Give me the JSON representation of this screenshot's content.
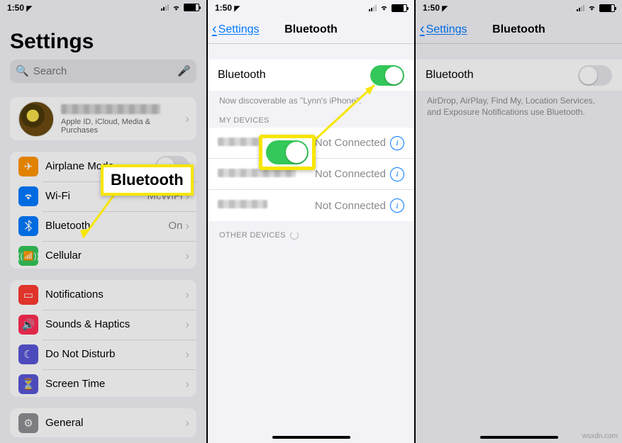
{
  "status": {
    "time": "1:50",
    "loc_arrow": "➤"
  },
  "pane1": {
    "title": "Settings",
    "search_placeholder": "Search",
    "profile_sub": "Apple ID, iCloud, Media & Purchases",
    "rows": {
      "airplane": "Airplane Mode",
      "wifi": "Wi-Fi",
      "wifi_val": "McWiFi",
      "bluetooth": "Bluetooth",
      "bluetooth_val": "On",
      "cellular": "Cellular",
      "notifications": "Notifications",
      "sounds": "Sounds & Haptics",
      "dnd": "Do Not Disturb",
      "screentime": "Screen Time",
      "general": "General"
    }
  },
  "pane2": {
    "back": "Settings",
    "title": "Bluetooth",
    "toggle_label": "Bluetooth",
    "discoverable": "Now discoverable as \"Lynn's iPhone\".",
    "section_my": "MY DEVICES",
    "section_other": "OTHER DEVICES",
    "not_connected": "Not Connected"
  },
  "pane3": {
    "back": "Settings",
    "title": "Bluetooth",
    "toggle_label": "Bluetooth",
    "note": "AirDrop, AirPlay, Find My, Location Services, and Exposure Notifications use Bluetooth."
  },
  "callout_label": "Bluetooth",
  "credit": "wsxdn.com"
}
